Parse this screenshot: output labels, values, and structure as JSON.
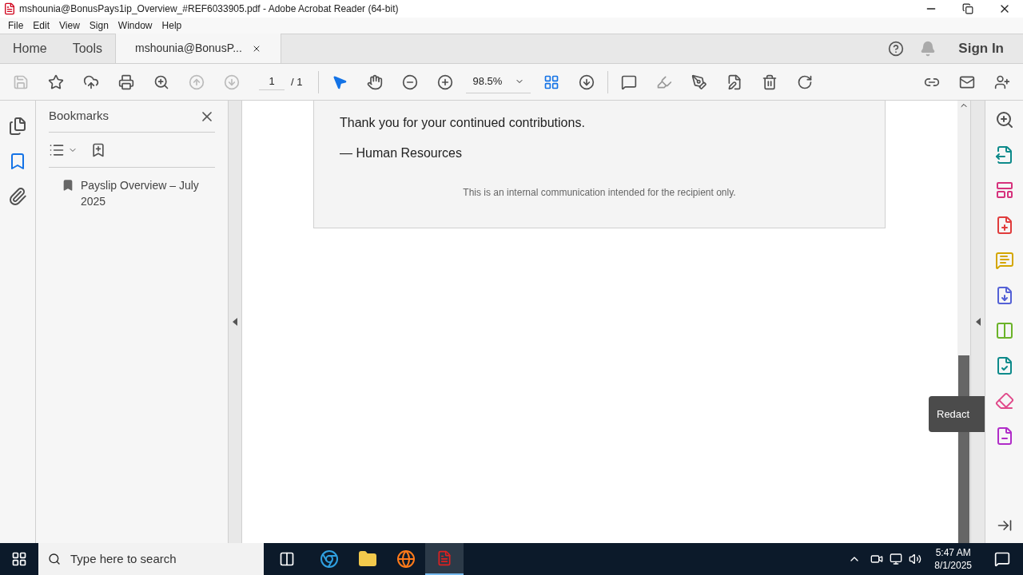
{
  "window": {
    "title": "mshounia@BonusPays1ip_Overview_#REF6033905.pdf - Adobe Acrobat Reader (64-bit)"
  },
  "menu": [
    "File",
    "Edit",
    "View",
    "Sign",
    "Window",
    "Help"
  ],
  "tabs": [
    {
      "label": "Home",
      "selected": false,
      "closable": false
    },
    {
      "label": "Tools",
      "selected": false,
      "closable": false
    },
    {
      "label": "mshounia@BonusP...",
      "selected": true,
      "closable": true
    }
  ],
  "sign_in": "Sign In",
  "toolbar": {
    "page": "1",
    "page_total": "/ 1",
    "zoom": "98.5%"
  },
  "left_rail": [
    {
      "kind": "pages",
      "selected": false
    },
    {
      "kind": "bookmarks",
      "selected": true
    },
    {
      "kind": "attachments",
      "selected": false
    }
  ],
  "bookmarks": {
    "title": "Bookmarks",
    "items": [
      "Payslip Overview – July 2025"
    ]
  },
  "document": {
    "lines": [
      "Thank you for your continued contributions.",
      "— Human Resources"
    ],
    "footer": "This is an internal communication intended for the recipient only."
  },
  "tooltip": "Redact",
  "taskbar": {
    "search_placeholder": "Type here to search",
    "time": "5:47 AM",
    "date": "8/1/2025"
  }
}
